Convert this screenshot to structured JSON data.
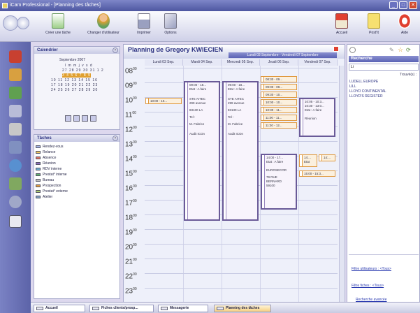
{
  "window": {
    "title": "iCam Professional - [Planning des tâches]",
    "minimize": "_",
    "maximize": "□",
    "close": "✕"
  },
  "toolbar": {
    "create_task": "Créer une tâche",
    "change_user": "Changer d'utilisateur",
    "print": "Imprimer",
    "options": "Options",
    "home": "Accueil",
    "postit": "Post'It",
    "help": "Aide"
  },
  "calendar": {
    "title": "Calendrier",
    "month": "Septembre 2007",
    "weekdays": "l m m j v s d",
    "rows": [
      "27 28 29 30 31 1 2",
      "3 4 5 6 7 8 9",
      "10 11 12 13 14 15 16",
      "17 18 19 20 21 22 23",
      "24 25 26 27 28 29 30"
    ]
  },
  "tasks": {
    "title": "Tâches",
    "items": [
      "Rendez-vous",
      "Relance",
      "Absence",
      "Réunion",
      "RDV interne",
      "Prestat° interne",
      "Bureau",
      "Prospection",
      "Prestat° externe",
      "Atelier"
    ]
  },
  "planning": {
    "title": "Planning de Gregory KWIECIEN",
    "range": "Lundi 03 Septembre - Vendredi 07 Septembre",
    "days": [
      "Lundi 03 Sep.",
      "Mardi 04 Sep.",
      "Mercredi 05 Sep.",
      "Jeudi 06 Sep.",
      "Vendredi 07 Sep."
    ],
    "hours": [
      "08",
      "09",
      "10",
      "11",
      "12",
      "13",
      "14",
      "15",
      "16",
      "17",
      "18",
      "19",
      "20",
      "21",
      "22",
      "23"
    ],
    "minutes": "00",
    "appts": {
      "mon_1000": "10:00 - 10...",
      "tue": [
        "09:00 - 18...",
        "Etat : A faire",
        "STE AITEC",
        "299 avenue",
        "83130 LA",
        "Tel :",
        "M. Fabrice",
        "Audit ICOn"
      ],
      "wed": [
        "09:00 - 18...",
        "Etat : A faire",
        "STE AITEC",
        "299 avenue",
        "83130 LA",
        "Tel :",
        "M. Fabrice",
        "Audit ICOn"
      ],
      "thu_list": [
        "08:30 - 09...",
        "09:00 - 09...",
        "09:30 - 10...",
        "10:00 - 10...",
        "10:30 - 11...",
        "11:00 - 11...",
        "11:30 - 12..."
      ],
      "thu_big": [
        "14:00 - 17...",
        "Etat : A faire",
        "EUROSECOR",
        "79 RUE",
        "BERNARD",
        "59100"
      ],
      "fri_1": [
        "10:05 - 10:3...",
        "10:30 - 13:0...",
        "Etat : A faire",
        "Réunion"
      ],
      "fri_14a": [
        "14:...",
        "Etat"
      ],
      "fri_14b": "14:...",
      "fri_1500": "15:00 - 15:3..."
    }
  },
  "search": {
    "heading": "Recherche",
    "input": "Li",
    "found": "Trouvé(s) : ",
    "results": [
      "LUDELL EUROPE",
      "LILL",
      "LLOYD CONTINENTAL",
      "LLOYD'S REGISTER"
    ],
    "filter_users": "Filtre utilisateurs : <Tous>",
    "filter_files": "Filtre fiches : <Tous>",
    "advanced": "Recherche avancée"
  },
  "bottom_tabs": [
    "Accueil",
    "Fiches clients/prosp...",
    "Messagerie",
    "Planning des tâches"
  ],
  "colors": {
    "accent": "#5a62b4",
    "appt_orange": "#e09a40",
    "appt_purple": "#6a5a98"
  }
}
